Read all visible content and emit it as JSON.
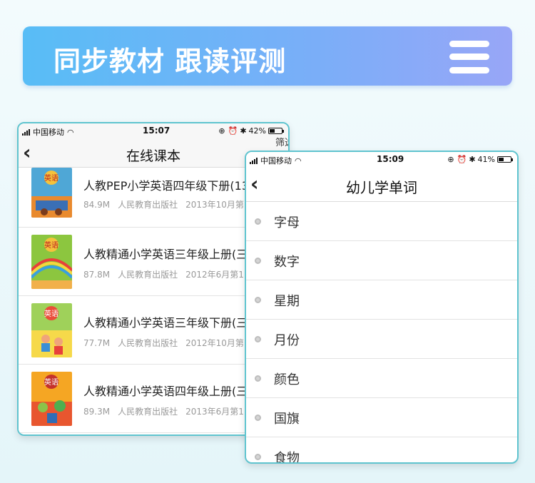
{
  "banner": {
    "title": "同步教材 跟读评测",
    "menu_icon": "hamburger-menu-icon"
  },
  "phone1": {
    "status": {
      "carrier": "中国移动",
      "time": "15:07",
      "battery": "42%"
    },
    "nav": {
      "title": "在线课本",
      "right_action": "筛选"
    },
    "books": [
      {
        "title": "人教PEP小学英语四年级下册(13",
        "size": "84.9M",
        "publisher": "人民教育出版社",
        "date": "2013年10月第"
      },
      {
        "title": "人教精通小学英语三年级上册(三",
        "size": "87.8M",
        "publisher": "人民教育出版社",
        "date": "2012年6月第1"
      },
      {
        "title": "人教精通小学英语三年级下册(三",
        "size": "77.7M",
        "publisher": "人民教育出版社",
        "date": "2012年10月第"
      },
      {
        "title": "人教精通小学英语四年级上册(三",
        "size": "89.3M",
        "publisher": "人民教育出版社",
        "date": "2013年6月第1"
      }
    ],
    "cover_label": "英语"
  },
  "phone2": {
    "status": {
      "carrier": "中国移动",
      "time": "15:09",
      "battery": "41%"
    },
    "nav": {
      "title": "幼儿学单词"
    },
    "words": [
      "字母",
      "数字",
      "星期",
      "月份",
      "颜色",
      "国旗",
      "食物"
    ]
  },
  "colors": {
    "banner_start": "#58bdf6",
    "banner_end": "#98a6f7",
    "phone_border": "#5fc4cf"
  }
}
